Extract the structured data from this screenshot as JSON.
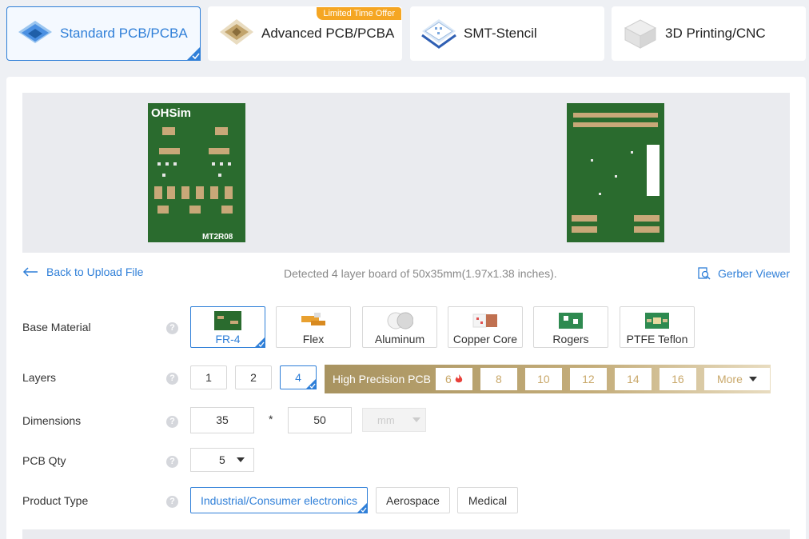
{
  "tabs": [
    {
      "label": "Standard PCB/PCBA",
      "active": true,
      "icon": "pcb-layers-icon"
    },
    {
      "label": "Advanced PCB/PCBA",
      "active": false,
      "icon": "chip-icon",
      "badge": "Limited Time Offer"
    },
    {
      "label": "SMT-Stencil",
      "active": false,
      "icon": "stencil-icon"
    },
    {
      "label": "3D Printing/CNC",
      "active": false,
      "icon": "3d-cube-icon"
    }
  ],
  "preview": {
    "front_board_label_top": "OHSim",
    "front_board_label_bottom": "MT2R08"
  },
  "info": {
    "back_label": "Back to Upload File",
    "detected_text": "Detected 4 layer board of 50x35mm(1.97x1.38 inches).",
    "gerber_label": "Gerber Viewer"
  },
  "base_material": {
    "label": "Base Material",
    "options": [
      {
        "label": "FR-4",
        "selected": true
      },
      {
        "label": "Flex",
        "selected": false
      },
      {
        "label": "Aluminum",
        "selected": false
      },
      {
        "label": "Copper Core",
        "selected": false
      },
      {
        "label": "Rogers",
        "selected": false
      },
      {
        "label": "PTFE Teflon",
        "selected": false
      }
    ]
  },
  "layers": {
    "label": "Layers",
    "options": [
      {
        "label": "1",
        "selected": false
      },
      {
        "label": "2",
        "selected": false
      },
      {
        "label": "4",
        "selected": true
      }
    ],
    "high_precision_title": "High Precision PCB",
    "high_precision_options": [
      "6",
      "8",
      "10",
      "12",
      "14",
      "16"
    ],
    "more_label": "More"
  },
  "dimensions": {
    "label": "Dimensions",
    "width": "35",
    "separator": "*",
    "height": "50",
    "unit": "mm"
  },
  "pcb_qty": {
    "label": "PCB Qty",
    "value": "5"
  },
  "product_type": {
    "label": "Product Type",
    "options": [
      {
        "label": "Industrial/Consumer electronics",
        "selected": true
      },
      {
        "label": "Aerospace",
        "selected": false
      },
      {
        "label": "Medical",
        "selected": false
      }
    ]
  },
  "help_glyph": "?",
  "colors": {
    "accent": "#2f7fd8",
    "board_green": "#2a6b2e",
    "gold": "#c9a86a",
    "offer_orange": "#f5a623"
  }
}
